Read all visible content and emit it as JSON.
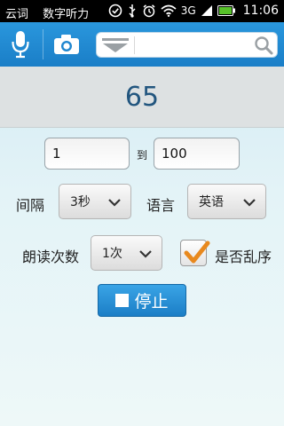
{
  "status_bar": {
    "left_items": [
      "云词",
      "数字听力"
    ],
    "network": "3G",
    "time": "11:06"
  },
  "toolbar": {
    "mic_icon": "microphone-icon",
    "camera_icon": "camera-icon",
    "search_placeholder": "",
    "search_icon": "magnifier-icon",
    "accent_color": "#1f86cf"
  },
  "display": {
    "number": "65"
  },
  "range": {
    "from_value": "1",
    "to_label": "到",
    "to_value": "100"
  },
  "interval": {
    "label": "间隔",
    "selected": "3秒"
  },
  "language": {
    "label": "语言",
    "selected": "英语"
  },
  "repeat": {
    "label": "朗读次数",
    "selected": "1次"
  },
  "shuffle": {
    "label": "是否乱序",
    "checked": true,
    "check_color": "#e8891e"
  },
  "actions": {
    "stop_label": "停止"
  }
}
